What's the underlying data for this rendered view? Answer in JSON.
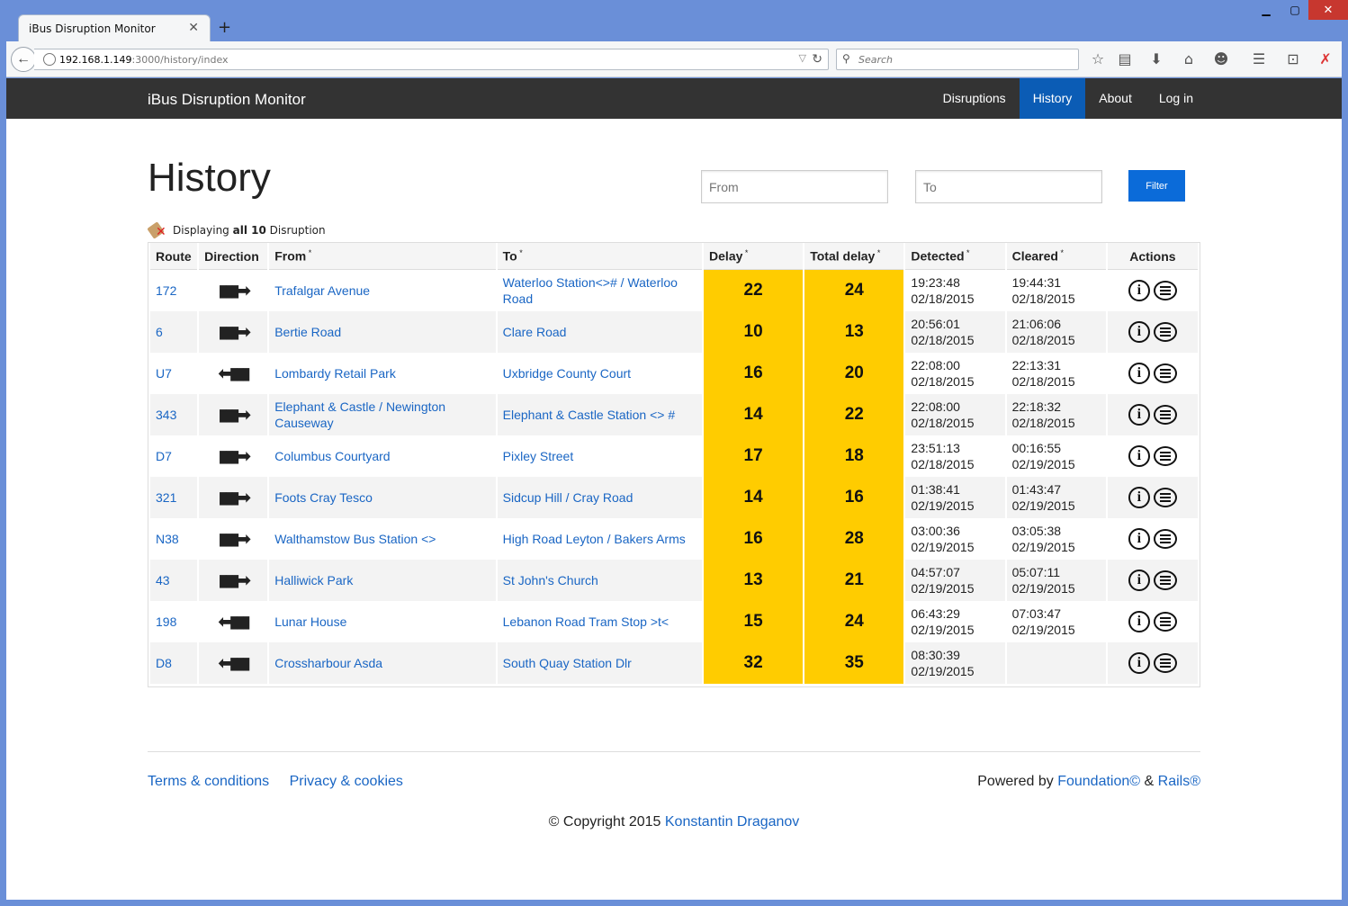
{
  "browser": {
    "tab_title": "iBus Disruption Monitor",
    "url_host": "192.168.1.149",
    "url_rest": ":3000/history/index",
    "search_placeholder": "Search"
  },
  "site": {
    "brand": "iBus Disruption Monitor",
    "nav": [
      {
        "label": "Disruptions",
        "active": false
      },
      {
        "label": "History",
        "active": true
      },
      {
        "label": "About",
        "active": false
      },
      {
        "label": "Log in",
        "active": false
      }
    ]
  },
  "page": {
    "title": "History",
    "from_placeholder": "From",
    "to_placeholder": "To",
    "filter_label": "Filter",
    "display_prefix": "Displaying",
    "display_all": "all 10",
    "display_suffix": "Disruption"
  },
  "table": {
    "headers": [
      {
        "label": "Route",
        "sort": false
      },
      {
        "label": "Direction",
        "sort": false
      },
      {
        "label": "From",
        "sort": true
      },
      {
        "label": "To",
        "sort": true
      },
      {
        "label": "Delay",
        "sort": true
      },
      {
        "label": "Total delay",
        "sort": true
      },
      {
        "label": "Detected",
        "sort": true
      },
      {
        "label": "Cleared",
        "sort": true
      },
      {
        "label": "Actions",
        "sort": false
      }
    ],
    "rows": [
      {
        "route": "172",
        "direction": "right",
        "from": "Trafalgar Avenue",
        "to": "Waterloo Station<>#  / Waterloo Road",
        "delay": "22",
        "total": "24",
        "detected_time": "19:23:48",
        "detected_date": "02/18/2015",
        "cleared_time": "19:44:31",
        "cleared_date": "02/18/2015"
      },
      {
        "route": "6",
        "direction": "right",
        "from": "Bertie Road",
        "to": "Clare Road",
        "delay": "10",
        "total": "13",
        "detected_time": "20:56:01",
        "detected_date": "02/18/2015",
        "cleared_time": "21:06:06",
        "cleared_date": "02/18/2015"
      },
      {
        "route": "U7",
        "direction": "left",
        "from": "Lombardy Retail Park",
        "to": "Uxbridge County Court",
        "delay": "16",
        "total": "20",
        "detected_time": "22:08:00",
        "detected_date": "02/18/2015",
        "cleared_time": "22:13:31",
        "cleared_date": "02/18/2015"
      },
      {
        "route": "343",
        "direction": "right",
        "from": "Elephant & Castle / Newington Causeway",
        "to": "Elephant & Castle Station <> #",
        "delay": "14",
        "total": "22",
        "detected_time": "22:08:00",
        "detected_date": "02/18/2015",
        "cleared_time": "22:18:32",
        "cleared_date": "02/18/2015"
      },
      {
        "route": "D7",
        "direction": "right",
        "from": "Columbus Courtyard",
        "to": "Pixley Street",
        "delay": "17",
        "total": "18",
        "detected_time": "23:51:13",
        "detected_date": "02/18/2015",
        "cleared_time": "00:16:55",
        "cleared_date": "02/19/2015"
      },
      {
        "route": "321",
        "direction": "right",
        "from": "Foots Cray Tesco",
        "to": "Sidcup Hill / Cray Road",
        "delay": "14",
        "total": "16",
        "detected_time": "01:38:41",
        "detected_date": "02/19/2015",
        "cleared_time": "01:43:47",
        "cleared_date": "02/19/2015"
      },
      {
        "route": "N38",
        "direction": "right",
        "from": "Walthamstow Bus Station <>",
        "to": "High Road Leyton / Bakers Arms",
        "delay": "16",
        "total": "28",
        "detected_time": "03:00:36",
        "detected_date": "02/19/2015",
        "cleared_time": "03:05:38",
        "cleared_date": "02/19/2015"
      },
      {
        "route": "43",
        "direction": "right",
        "from": "Halliwick Park",
        "to": "St John's Church",
        "delay": "13",
        "total": "21",
        "detected_time": "04:57:07",
        "detected_date": "02/19/2015",
        "cleared_time": "05:07:11",
        "cleared_date": "02/19/2015"
      },
      {
        "route": "198",
        "direction": "left",
        "from": "Lunar House",
        "to": "Lebanon Road Tram Stop >t<",
        "delay": "15",
        "total": "24",
        "detected_time": "06:43:29",
        "detected_date": "02/19/2015",
        "cleared_time": "07:03:47",
        "cleared_date": "02/19/2015"
      },
      {
        "route": "D8",
        "direction": "left",
        "from": "Crossharbour Asda",
        "to": "South Quay Station Dlr",
        "delay": "32",
        "total": "35",
        "detected_time": "08:30:39",
        "detected_date": "02/19/2015",
        "cleared_time": "",
        "cleared_date": ""
      }
    ]
  },
  "footer": {
    "terms": "Terms & conditions",
    "privacy": "Privacy & cookies",
    "powered_prefix": "Powered by",
    "foundation": "Foundation©",
    "amp": "&",
    "rails": "Rails®",
    "copyright_prefix": "© Copyright 2015",
    "author": "Konstantin Draganov"
  },
  "colors": {
    "topbar": "#333333",
    "nav_active": "#0b5cb5",
    "delay_cell": "#ffcc00",
    "link": "#1a66c4"
  }
}
